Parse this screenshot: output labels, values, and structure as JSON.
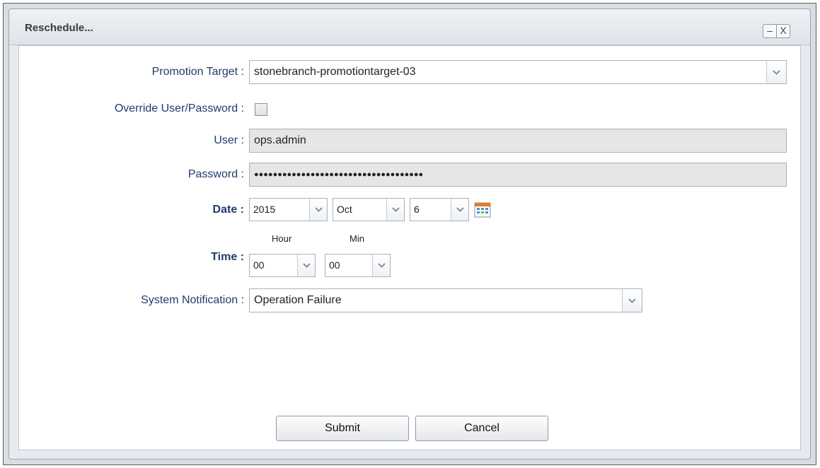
{
  "dialog": {
    "title": "Reschedule...",
    "minimize_glyph": "–",
    "close_glyph": "X"
  },
  "form": {
    "promotion_target": {
      "label": "Promotion Target :",
      "value": "stonebranch-promotiontarget-03"
    },
    "override": {
      "label": "Override User/Password :",
      "checked": false
    },
    "user": {
      "label": "User :",
      "value": "ops.admin"
    },
    "password": {
      "label": "Password :",
      "value": "●●●●●●●●●●●●●●●●●●●●●●●●●●●●●●●●●●●●"
    },
    "date": {
      "label": "Date :",
      "year": "2015",
      "month": "Oct",
      "day": "6"
    },
    "time": {
      "label": "Time :",
      "hour_label": "Hour",
      "min_label": "Min",
      "hour": "00",
      "min": "00"
    },
    "system_notification": {
      "label": "System Notification :",
      "value": "Operation Failure"
    }
  },
  "buttons": {
    "submit": "Submit",
    "cancel": "Cancel"
  },
  "icons": {
    "calendar": "calendar-icon",
    "dropdown": "chevron-down-icon",
    "minimize": "minimize-icon",
    "close": "close-icon"
  },
  "colors": {
    "label_text": "#1f3d6b",
    "disabled_field": "#e6e6e6"
  }
}
